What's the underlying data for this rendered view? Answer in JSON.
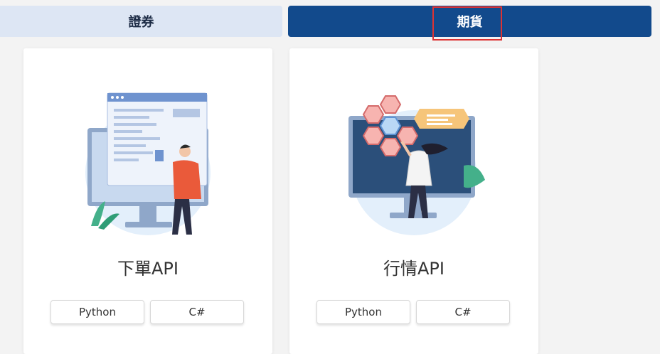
{
  "tabs": {
    "securities": "證券",
    "futures": "期貨"
  },
  "cards": [
    {
      "title": "下單API",
      "buttons": [
        "Python",
        "C#"
      ],
      "illustration": "order-api-illustration"
    },
    {
      "title": "行情API",
      "buttons": [
        "Python",
        "C#"
      ],
      "illustration": "quote-api-illustration"
    }
  ],
  "colors": {
    "active_tab": "#124a8c",
    "inactive_tab": "#dde6f4",
    "highlight": "#dd3333"
  }
}
